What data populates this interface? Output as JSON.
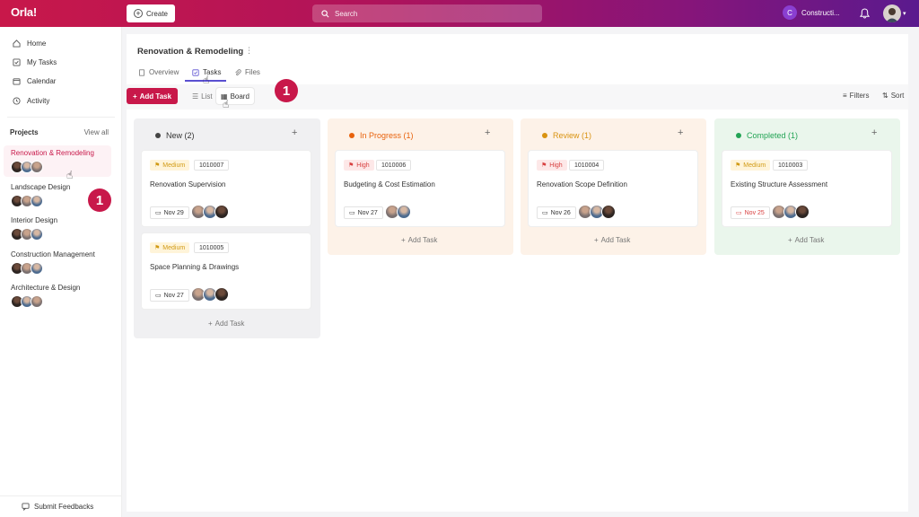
{
  "topbar": {
    "logo": "Orla!",
    "create_label": "Create",
    "search_placeholder": "Search",
    "workspace_initial": "C",
    "workspace_name": "Constructi..."
  },
  "sidebar": {
    "nav": [
      {
        "label": "Home",
        "icon": "home-icon"
      },
      {
        "label": "My Tasks",
        "icon": "check-square-icon"
      },
      {
        "label": "Calendar",
        "icon": "calendar-icon"
      },
      {
        "label": "Activity",
        "icon": "history-icon"
      }
    ],
    "projects_title": "Projects",
    "view_all": "View all",
    "projects": [
      {
        "name": "Renovation & Remodeling",
        "active": true
      },
      {
        "name": "Landscape Design"
      },
      {
        "name": "Interior Design"
      },
      {
        "name": "Construction Management"
      },
      {
        "name": "Architecture & Design"
      }
    ],
    "feedback_label": "Submit Feedbacks"
  },
  "main": {
    "project_title": "Renovation & Remodeling",
    "tabs": [
      {
        "label": "Overview"
      },
      {
        "label": "Tasks",
        "active": true
      },
      {
        "label": "Files"
      }
    ],
    "add_task_label": "Add Task",
    "views": [
      {
        "label": "List"
      },
      {
        "label": "Board",
        "active": true
      }
    ],
    "filters_label": "Filters",
    "sort_label": "Sort",
    "columns": [
      {
        "label": "New (2)",
        "color": "#444444",
        "bg": "#f0f0f2",
        "add_label": "Add Task",
        "cards": [
          {
            "priority": "Medium",
            "id": "1010007",
            "title": "Renovation Supervision",
            "due": "Nov 29"
          },
          {
            "priority": "Medium",
            "id": "1010005",
            "title": "Space Planning & Drawings",
            "due": "Nov 27"
          }
        ]
      },
      {
        "label": "In Progress (1)",
        "color": "#e8620c",
        "bg": "#fdf2e8",
        "add_label": "Add Task",
        "cards": [
          {
            "priority": "High",
            "id": "1010006",
            "title": "Budgeting & Cost Estimation",
            "due": "Nov 27"
          }
        ]
      },
      {
        "label": "Review (1)",
        "color": "#d99311",
        "bg": "#fdf2e8",
        "add_label": "Add Task",
        "cards": [
          {
            "priority": "High",
            "id": "1010004",
            "title": "Renovation Scope Definition",
            "due": "Nov 26"
          }
        ]
      },
      {
        "label": "Completed (1)",
        "color": "#23a455",
        "bg": "#eaf6ec",
        "add_label": "Add Task",
        "cards": [
          {
            "priority": "Medium",
            "id": "1010003",
            "title": "Existing Structure Assessment",
            "due": "Nov 25"
          }
        ]
      }
    ]
  },
  "annotations": {
    "step_badge_1": "1",
    "step_badge_2": "1"
  },
  "colors": {
    "brand": "#c8184a",
    "accent_tab": "#5a4fd1"
  }
}
